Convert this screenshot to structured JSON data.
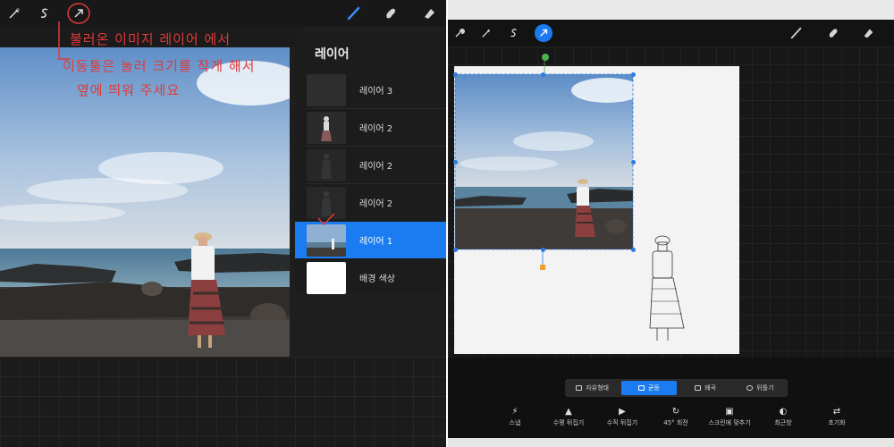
{
  "left_panel": {
    "toolbar_icons": [
      "adjust-wand-icon",
      "selection-s-icon",
      "transform-arrow-icon"
    ],
    "right_tools": [
      "brush-icon",
      "smudge-icon",
      "eraser-icon"
    ],
    "annotation": {
      "line1": "불러온 이미지 레이어 에서",
      "line2": "이동툴은 눌러 크기를 작게 해서",
      "line3": "옆에 띄워 주세요"
    },
    "layers_panel": {
      "title": "레이어",
      "items": [
        {
          "label": "레이어 3",
          "selected": false
        },
        {
          "label": "레이어 2",
          "selected": false
        },
        {
          "label": "레이어 2",
          "selected": false
        },
        {
          "label": "레이어 2",
          "selected": false
        },
        {
          "label": "레이어 1",
          "selected": true
        },
        {
          "label": "배경 색상",
          "selected": false
        }
      ]
    }
  },
  "right_panel": {
    "toolbar_icons": [
      "wrench-icon",
      "adjust-wand-icon",
      "selection-s-icon",
      "transform-arrow-icon"
    ],
    "right_tools": [
      "brush-icon",
      "smudge-icon",
      "eraser-icon"
    ],
    "transform_modes": [
      {
        "label": "자유형태",
        "active": false
      },
      {
        "label": "균등",
        "active": true
      },
      {
        "label": "왜곡",
        "active": false
      },
      {
        "label": "뒤틀기",
        "active": false
      }
    ],
    "actions": [
      {
        "label": "스냅",
        "icon": "lightning-icon"
      },
      {
        "label": "수평 뒤집기",
        "icon": "flip-horizontal-icon"
      },
      {
        "label": "수직 뒤집기",
        "icon": "flip-vertical-icon"
      },
      {
        "label": "45° 회전",
        "icon": "rotate-icon"
      },
      {
        "label": "스크린에 맞추기",
        "icon": "fit-screen-icon"
      },
      {
        "label": "최근방",
        "icon": "interpolation-icon"
      },
      {
        "label": "초기화",
        "icon": "reset-icon"
      }
    ]
  },
  "colors": {
    "accent_blue": "#1a7cf0",
    "annotation_red": "#e03a3a",
    "handle_blue": "#2c7be5",
    "rotate_handle_green": "#4caf50",
    "pivot_orange": "#f0a030"
  }
}
